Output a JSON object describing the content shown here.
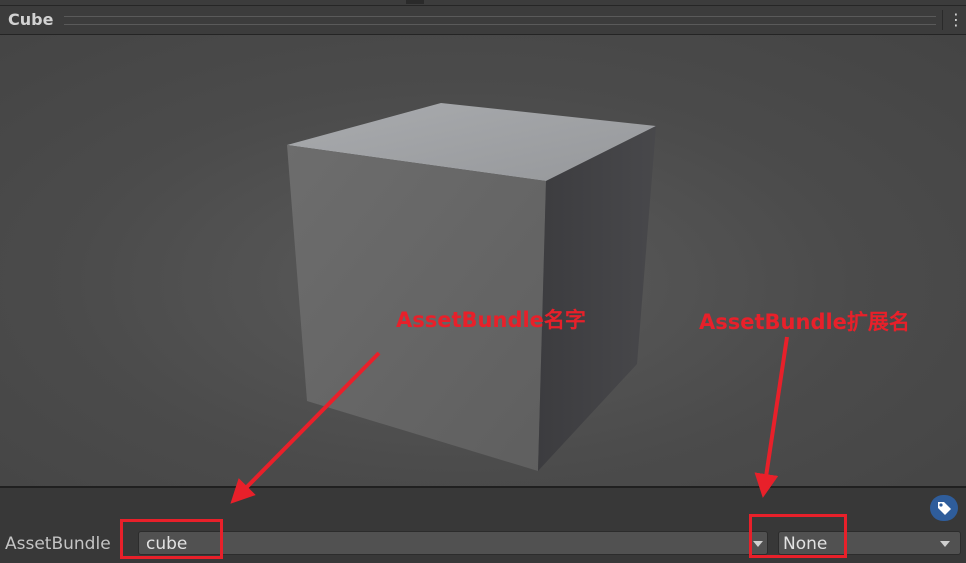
{
  "top_strip": {
    "partial_text": ""
  },
  "header": {
    "title": "Cube",
    "menu_icon": "kebab-menu-icon"
  },
  "preview": {
    "object": "cube"
  },
  "asset_bundle": {
    "label": "AssetBundle",
    "name_value": "cube",
    "variant_value": "None",
    "tag_icon": "tag-icon"
  },
  "annotations": {
    "name_label": "AssetBundle名字",
    "ext_label": "AssetBundle扩展名",
    "color": "#e8202a"
  },
  "colors": {
    "background": "#383838",
    "preview": "#4f4f4f",
    "tag_button": "#2f5d9b",
    "annotation": "#e8202a"
  }
}
